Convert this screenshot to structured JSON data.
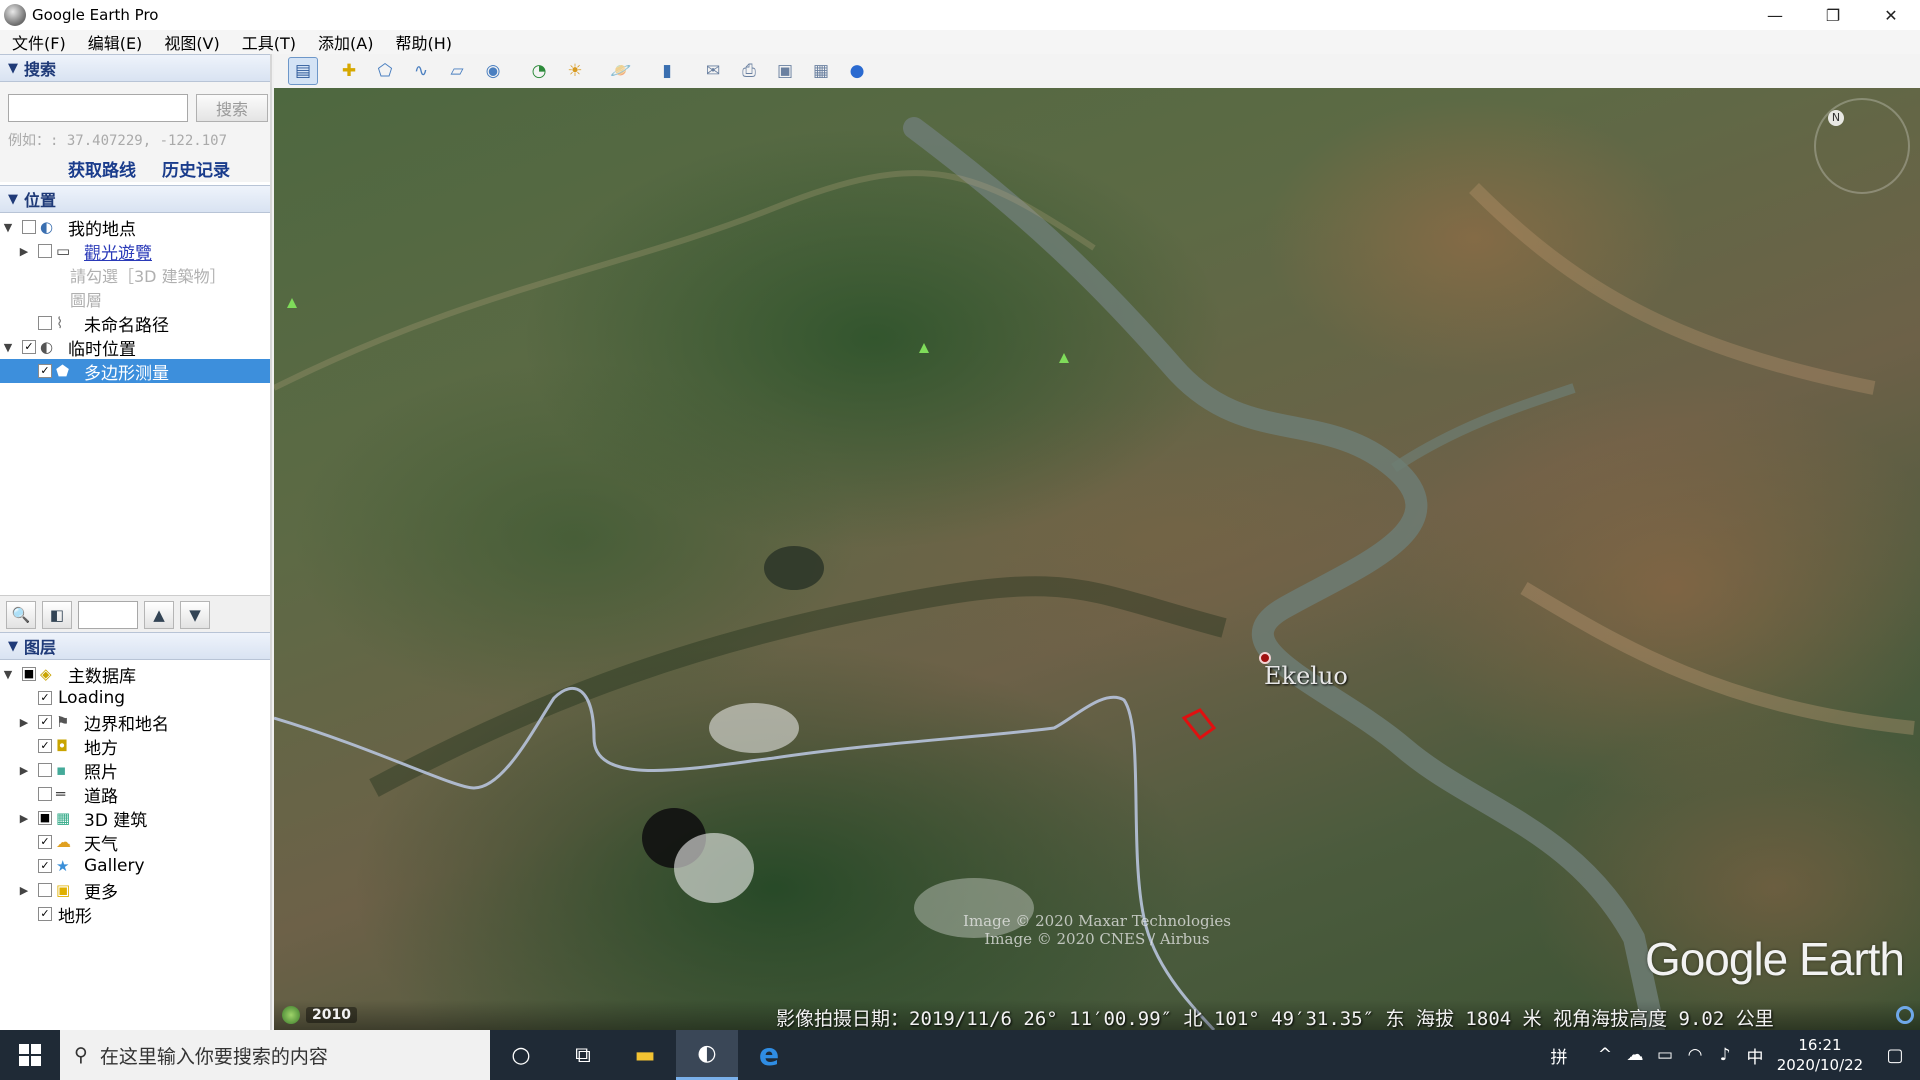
{
  "window": {
    "title": "Google Earth Pro",
    "controls": {
      "minimize": "—",
      "restore": "❐",
      "close": "✕"
    }
  },
  "menu": [
    "文件(F)",
    "编辑(E)",
    "视图(V)",
    "工具(T)",
    "添加(A)",
    "帮助(H)"
  ],
  "search": {
    "header": "搜索",
    "input_value": "",
    "button_label": "搜索",
    "hint": "例如：: 37.407229, -122.107",
    "links": [
      "获取路线",
      "历史记录"
    ]
  },
  "places": {
    "header": "位置",
    "items": [
      {
        "label": "我的地点",
        "level": 0,
        "expander": "▼",
        "checkbox": "",
        "icon": "globe-icon"
      },
      {
        "label": "觀光遊覽",
        "level": 1,
        "expander": "▶",
        "checkbox": "",
        "icon": "folder-icon",
        "link": true
      },
      {
        "label": "請勾選［3D 建築物］",
        "level": 2,
        "note": true
      },
      {
        "label": "圖層",
        "level": 2,
        "note": true
      },
      {
        "label": "未命名路径",
        "level": 1,
        "expander": "",
        "checkbox": "",
        "icon": "path-icon"
      },
      {
        "label": "临时位置",
        "level": 0,
        "expander": "▼",
        "checkbox": "✓",
        "icon": "temp-places-icon"
      },
      {
        "label": "多边形测量",
        "level": 1,
        "expander": "",
        "checkbox": "✓",
        "icon": "polygon-icon",
        "selected": true
      }
    ]
  },
  "layers": {
    "header": "图层",
    "items": [
      {
        "label": "主数据库",
        "level": 0,
        "expander": "▼",
        "checkbox": "■",
        "icon": "database-icon"
      },
      {
        "label": "Loading",
        "level": 1,
        "expander": "",
        "checkbox": "✓",
        "icon": ""
      },
      {
        "label": "边界和地名",
        "level": 1,
        "expander": "▶",
        "checkbox": "✓",
        "icon": "flag-icon"
      },
      {
        "label": "地方",
        "level": 1,
        "expander": "",
        "checkbox": "✓",
        "icon": "places-layer-icon"
      },
      {
        "label": "照片",
        "level": 1,
        "expander": "▶",
        "checkbox": "",
        "icon": "photo-icon"
      },
      {
        "label": "道路",
        "level": 1,
        "expander": "",
        "checkbox": "",
        "icon": "road-icon"
      },
      {
        "label": "3D 建筑",
        "level": 1,
        "expander": "▶",
        "checkbox": "■",
        "icon": "building-icon"
      },
      {
        "label": "天气",
        "level": 1,
        "expander": "",
        "checkbox": "✓",
        "icon": "weather-icon"
      },
      {
        "label": "Gallery",
        "level": 1,
        "expander": "",
        "checkbox": "✓",
        "icon": "gallery-icon"
      },
      {
        "label": "更多",
        "level": 1,
        "expander": "▶",
        "checkbox": "",
        "icon": "more-icon"
      },
      {
        "label": "地形",
        "level": 1,
        "expander": "",
        "checkbox": "✓",
        "icon": ""
      }
    ]
  },
  "map": {
    "place_label": "Ekeluo",
    "attribution": [
      "Image © 2020 Maxar Technologies",
      "Image © 2020 CNES / Airbus"
    ],
    "logo": "Google Earth",
    "compass_n": "N"
  },
  "status": {
    "year": "2010",
    "info": "影像拍摄日期：2019/11/6   26° 11′00.99″ 北 101° 49′31.35″ 东 海拔  1804 米   视角海拔高度   9.02 公里"
  },
  "taskbar": {
    "search_placeholder": "在这里输入你要搜索的内容",
    "tray": {
      "ime_mode": "拼",
      "lang": "中",
      "time": "16:21",
      "date": "2020/10/22"
    }
  },
  "colors": {
    "selected": "#3d8fdc",
    "header_text": "#1f3a78",
    "link": "#1a3c8c"
  }
}
